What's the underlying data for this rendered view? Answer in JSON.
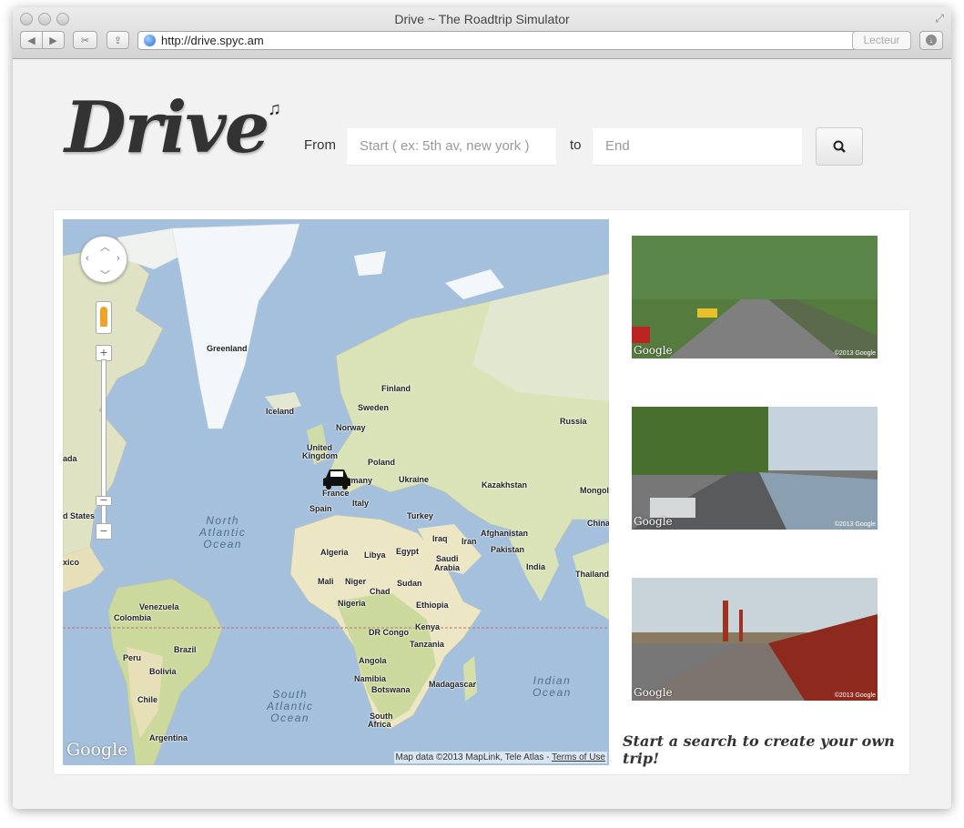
{
  "window": {
    "title": "Drive ~ The Roadtrip Simulator",
    "url": "http://drive.spyc.am",
    "reader_label": "Lecteur"
  },
  "header": {
    "logo": "Drive",
    "from_label": "From",
    "start_placeholder": "Start ( ex: 5th av, new york )",
    "to_label": "to",
    "end_placeholder": "End"
  },
  "map": {
    "labels": [
      {
        "text": "Greenland"
      },
      {
        "text": "Iceland"
      },
      {
        "text": "Finland"
      },
      {
        "text": "Sweden"
      },
      {
        "text": "Norway"
      },
      {
        "text": "Russia"
      },
      {
        "text": "United"
      },
      {
        "text": "Kingdom"
      },
      {
        "text": "Poland"
      },
      {
        "text": "rmany"
      },
      {
        "text": "Ukraine"
      },
      {
        "text": "Kazakhstan"
      },
      {
        "text": "Mongoli"
      },
      {
        "text": "France"
      },
      {
        "text": "Italy"
      },
      {
        "text": "Spain"
      },
      {
        "text": "Turkey"
      },
      {
        "text": "China"
      },
      {
        "text": "ada"
      },
      {
        "text": "d States"
      },
      {
        "text": "Iraq"
      },
      {
        "text": "Iran"
      },
      {
        "text": "Afghanistan"
      },
      {
        "text": "Pakistan"
      },
      {
        "text": "Algeria"
      },
      {
        "text": "Libya"
      },
      {
        "text": "Egypt"
      },
      {
        "text": "Saudi"
      },
      {
        "text": "Arabia"
      },
      {
        "text": "India"
      },
      {
        "text": "xico"
      },
      {
        "text": "Mali"
      },
      {
        "text": "Niger"
      },
      {
        "text": "Chad"
      },
      {
        "text": "Sudan"
      },
      {
        "text": "Thailand"
      },
      {
        "text": "Nigeria"
      },
      {
        "text": "Ethiopia"
      },
      {
        "text": "Venezuela"
      },
      {
        "text": "Colombia"
      },
      {
        "text": "Kenya"
      },
      {
        "text": "DR Congo"
      },
      {
        "text": "Tanzania"
      },
      {
        "text": "Peru"
      },
      {
        "text": "Brazil"
      },
      {
        "text": "Bolivia"
      },
      {
        "text": "Angola"
      },
      {
        "text": "Namibia"
      },
      {
        "text": "Botswana"
      },
      {
        "text": "Madagascar"
      },
      {
        "text": "Chile"
      },
      {
        "text": "South"
      },
      {
        "text": "Africa"
      },
      {
        "text": "Argentina"
      }
    ],
    "oceans": [
      {
        "text": "North\nAtlantic\nOcean"
      },
      {
        "text": "South\nAtlantic\nOcean"
      },
      {
        "text": "Indian\nOcean"
      }
    ],
    "google_logo": "Google",
    "attribution": "Map data ©2013 MapLink, Tele Atlas - ",
    "terms": "Terms of Use"
  },
  "thumbnails": [
    {
      "logo": "Google",
      "copy": "©2013 Google"
    },
    {
      "logo": "Google",
      "copy": "©2013 Google"
    },
    {
      "logo": "Google",
      "copy": "©2013 Google"
    }
  ],
  "cta": "Start a search to create your own trip!",
  "colors": {
    "ocean": "#a4c0dc",
    "land": "#e9e5c8",
    "green": "#c5d89a",
    "ice": "#f4f7fa"
  }
}
